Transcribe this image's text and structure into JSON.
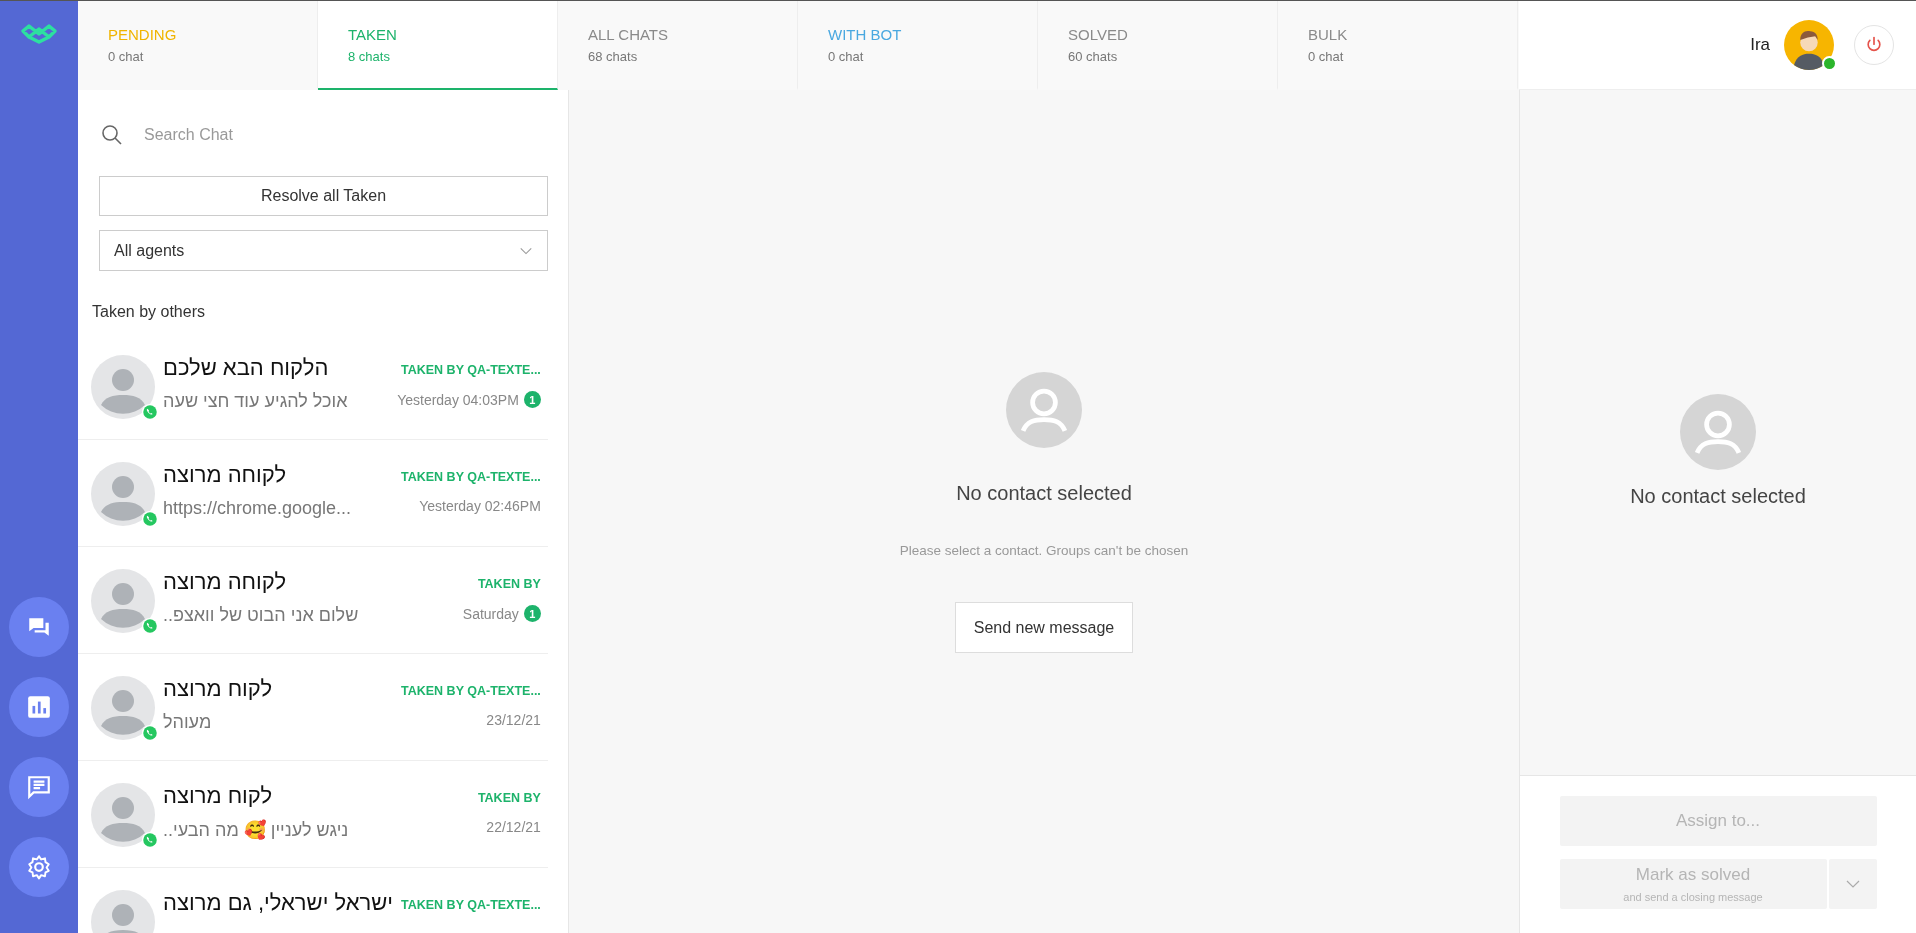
{
  "tabs": [
    {
      "label": "PENDING",
      "count": "0 chat",
      "color": "#f0b400",
      "selected": false
    },
    {
      "label": "TAKEN",
      "count": "8 chats",
      "color": "#1db36b",
      "selected": true
    },
    {
      "label": "ALL CHATS",
      "count": "68 chats",
      "color": "#8a8a8a",
      "selected": false
    },
    {
      "label": "WITH BOT",
      "count": "0 chat",
      "color": "#4aa8e0",
      "selected": false
    },
    {
      "label": "SOLVED",
      "count": "60 chats",
      "color": "#8a8a8a",
      "selected": false
    },
    {
      "label": "BULK",
      "count": "0 chat",
      "color": "#8a8a8a",
      "selected": false
    }
  ],
  "user": {
    "name": "Ira",
    "online": true
  },
  "search": {
    "placeholder": "Search Chat"
  },
  "resolve_button": "Resolve all Taken",
  "agent_filter": {
    "value": "All agents"
  },
  "section_title": "Taken by others",
  "chats": [
    {
      "name": "הלקוח הבא שלכם",
      "preview": "אוכל להגיע עוד חצי שעה",
      "taken_by": "TAKEN BY QA-TEXTE...",
      "time": "Yesterday 04:03PM",
      "unread": "1"
    },
    {
      "name": "לקוחה מרוצה",
      "preview": "https://chrome.google...",
      "taken_by": "TAKEN BY QA-TEXTE...",
      "time": "Yesterday 02:46PM"
    },
    {
      "name": "לקוחה מרוצה",
      "preview": "שלום אני הבוט של וואצפ..",
      "taken_by": "TAKEN BY",
      "time": "Saturday",
      "unread": "1"
    },
    {
      "name": "לקוח מרוצה",
      "preview": "מעוהל",
      "taken_by": "TAKEN BY QA-TEXTE...",
      "time": "23/12/21"
    },
    {
      "name": "לקוח מרוצה",
      "preview": "ניגש לעניין 🥰 מה הבעי..",
      "taken_by": "TAKEN BY",
      "time": "22/12/21"
    },
    {
      "name": "ישראל ישראלי, גם מרוצה",
      "taken_by": "TAKEN BY QA-TEXTE..."
    }
  ],
  "center": {
    "title": "No contact selected",
    "hint": "Please select a contact. Groups can't be chosen",
    "button": "Send new message"
  },
  "details": {
    "title": "No contact selected",
    "assign_button": {
      "label": "Assign to...",
      "disabled": true
    },
    "solve_button": {
      "label": "Mark as solved",
      "sublabel": "and send a closing message",
      "disabled": true
    }
  }
}
